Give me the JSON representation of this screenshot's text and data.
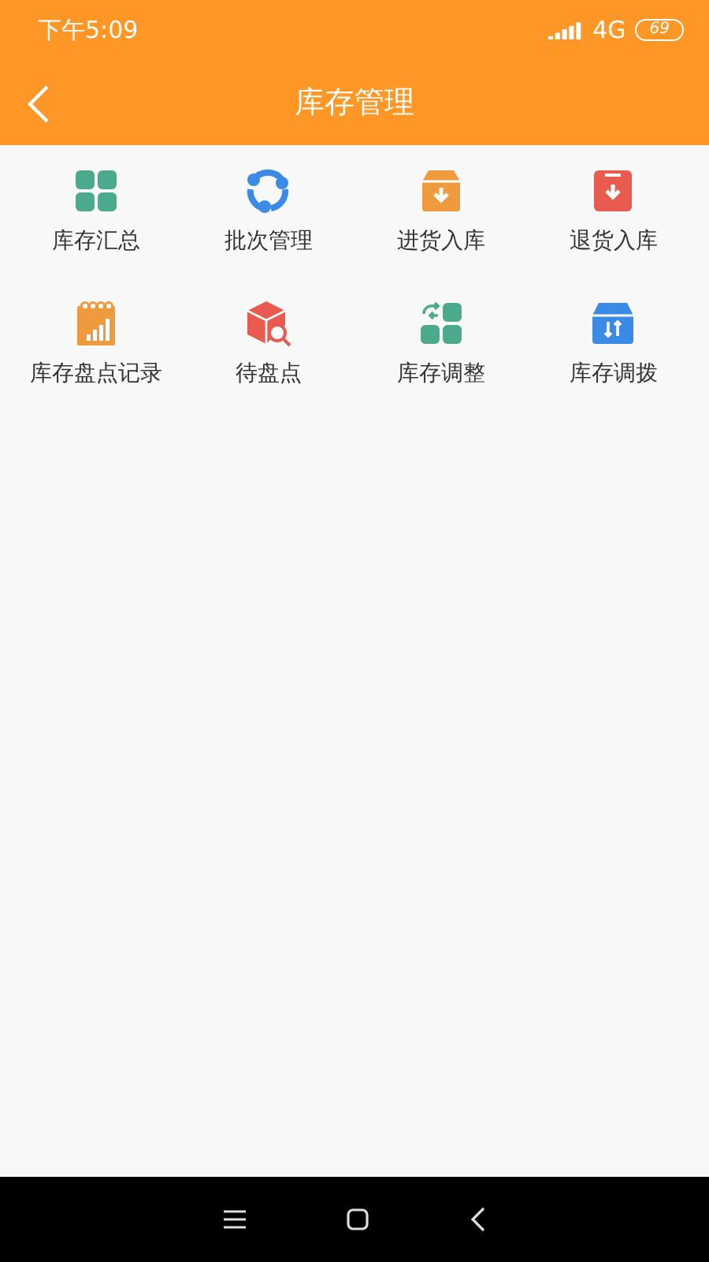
{
  "status_bar": {
    "time": "下午5:09",
    "network": "4G",
    "battery": "69"
  },
  "header": {
    "title": "库存管理"
  },
  "menu": [
    {
      "label": "库存汇总",
      "kind": "grid",
      "color": "#4caa8c"
    },
    {
      "label": "批次管理",
      "kind": "cycle",
      "color": "#3a8ae6"
    },
    {
      "label": "进货入库",
      "kind": "boxin",
      "color": "#ef9a3c"
    },
    {
      "label": "退货入库",
      "kind": "clipdown",
      "color": "#e95b4f"
    },
    {
      "label": "库存盘点记录",
      "kind": "calendar",
      "color": "#ef9a3c"
    },
    {
      "label": "待盘点",
      "kind": "boxsearch",
      "color": "#e95b4f"
    },
    {
      "label": "库存调整",
      "kind": "swapgrid",
      "color": "#4caa8c"
    },
    {
      "label": "库存调拨",
      "kind": "boxswap",
      "color": "#3a8ae6"
    }
  ]
}
